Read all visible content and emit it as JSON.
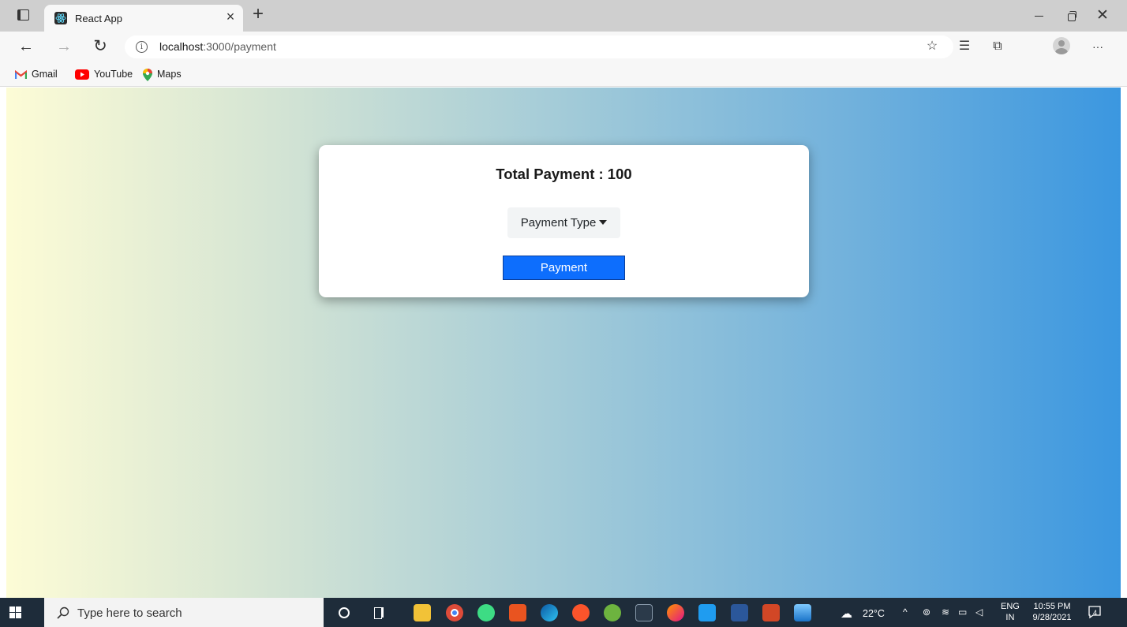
{
  "browser": {
    "tab": {
      "title": "React App"
    },
    "omnibox": {
      "host": "localhost",
      "path": ":3000/payment"
    },
    "bookmarks": [
      {
        "label": "Gmail",
        "icon": "gmail-icon"
      },
      {
        "label": "YouTube",
        "icon": "youtube-icon"
      },
      {
        "label": "Maps",
        "icon": "maps-icon"
      }
    ]
  },
  "page": {
    "background_colors": [
      "#fdfcd6",
      "#3b97e0"
    ],
    "card": {
      "title": "Total Payment : 100",
      "dropdown_label": "Payment Type",
      "pay_button_label": "Payment",
      "button_color": "#0d6efd"
    }
  },
  "taskbar": {
    "search_placeholder": "Type here to search",
    "weather": "22°C",
    "language": {
      "line1": "ENG",
      "line2": "IN"
    },
    "clock": {
      "time": "10:55 PM",
      "date": "9/28/2021"
    },
    "notification_count": "4",
    "apps": [
      "file-explorer-icon",
      "chrome-icon",
      "android-studio-icon",
      "ubuntu-icon",
      "edge-icon",
      "brave-icon",
      "spring-tools-icon",
      "terminal-icon",
      "firefox-icon",
      "vscode-icon",
      "word-icon",
      "powerpoint-icon",
      "photos-icon"
    ]
  }
}
